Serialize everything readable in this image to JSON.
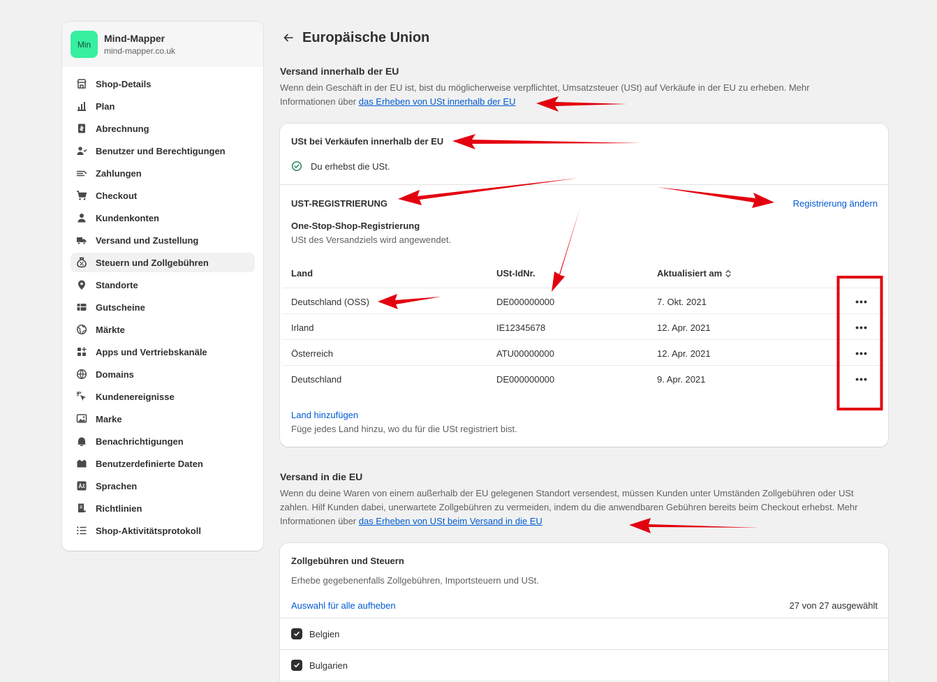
{
  "store": {
    "avatar_text": "Min",
    "name": "Mind-Mapper",
    "url": "mind-mapper.co.uk"
  },
  "sidebar": {
    "items": [
      {
        "label": "Shop-Details",
        "icon": "store-icon"
      },
      {
        "label": "Plan",
        "icon": "plan-icon"
      },
      {
        "label": "Abrechnung",
        "icon": "billing-icon"
      },
      {
        "label": "Benutzer und Berechtigungen",
        "icon": "users-icon"
      },
      {
        "label": "Zahlungen",
        "icon": "payments-icon"
      },
      {
        "label": "Checkout",
        "icon": "cart-icon"
      },
      {
        "label": "Kundenkonten",
        "icon": "person-icon"
      },
      {
        "label": "Versand und Zustellung",
        "icon": "truck-icon"
      },
      {
        "label": "Steuern und Zollgebühren",
        "icon": "taxes-icon",
        "active": true
      },
      {
        "label": "Standorte",
        "icon": "location-icon"
      },
      {
        "label": "Gutscheine",
        "icon": "gift-card-icon"
      },
      {
        "label": "Märkte",
        "icon": "globe-icon"
      },
      {
        "label": "Apps und Vertriebskanäle",
        "icon": "apps-icon"
      },
      {
        "label": "Domains",
        "icon": "domains-icon"
      },
      {
        "label": "Kundenereignisse",
        "icon": "cursor-click-icon"
      },
      {
        "label": "Marke",
        "icon": "brand-icon"
      },
      {
        "label": "Benachrichtigungen",
        "icon": "bell-icon"
      },
      {
        "label": "Benutzerdefinierte Daten",
        "icon": "custom-data-icon"
      },
      {
        "label": "Sprachen",
        "icon": "language-icon"
      },
      {
        "label": "Richtlinien",
        "icon": "policies-icon"
      },
      {
        "label": "Shop-Aktivitätsprotokoll",
        "icon": "list-icon"
      }
    ]
  },
  "page": {
    "title": "Europäische Union"
  },
  "section1": {
    "title": "Versand innerhalb der EU",
    "desc": "Wenn dein Geschäft in der EU ist, bist du möglicherweise verpflichtet, Umsatzsteuer (USt) auf Verkäufe in der EU zu erheben. Mehr Informationen über ",
    "link": "das Erheben von USt innerhalb der EU"
  },
  "vat_card": {
    "title": "USt bei Verkäufen innerhalb der EU",
    "status": "Du erhebst die USt.",
    "reg_heading": "UST-REGISTRIERUNG",
    "change_link": "Registrierung ändern",
    "oss_title": "One-Stop-Shop-Registrierung",
    "oss_desc": "USt des Versandziels wird angewendet.",
    "columns": [
      "Land",
      "USt-IdNr.",
      "Aktualisiert am"
    ],
    "rows": [
      {
        "country": "Deutschland (OSS)",
        "vat": "DE000000000",
        "updated": "7. Okt. 2021"
      },
      {
        "country": "Irland",
        "vat": "IE12345678",
        "updated": "12. Apr. 2021"
      },
      {
        "country": "Österreich",
        "vat": "ATU00000000",
        "updated": "12. Apr. 2021"
      },
      {
        "country": "Deutschland",
        "vat": "DE000000000",
        "updated": "9. Apr. 2021"
      }
    ],
    "more_actions": "•••",
    "add_link": "Land hinzufügen",
    "add_desc": "Füge jedes Land hinzu, wo du für die USt registriert bist."
  },
  "section2": {
    "title": "Versand in die EU",
    "desc": "Wenn du deine Waren von einem außerhalb der EU gelegenen Standort versendest, müssen Kunden unter Umständen Zollgebühren oder USt zahlen. Hilf Kunden dabei, unerwartete Zollgebühren zu vermeiden, indem du die anwendbaren Gebühren bereits beim Checkout erhebst. Mehr Informationen über ",
    "link": "das Erheben von USt beim Versand in die EU"
  },
  "duties_card": {
    "title": "Zollgebühren und Steuern",
    "desc": "Erhebe gegebenenfalls Zollgebühren, Importsteuern und USt.",
    "deselect_link": "Auswahl für alle aufheben",
    "selected_count": "27 von 27 ausgewählt",
    "countries": [
      "Belgien",
      "Bulgarien"
    ]
  },
  "colors": {
    "accent_link": "#005bd3",
    "annotation_red": "#e3000f",
    "avatar_green": "#36f0a0",
    "success_green": "#29845a"
  }
}
